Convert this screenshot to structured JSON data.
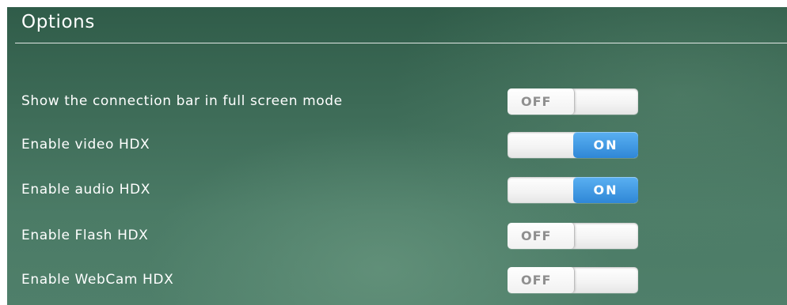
{
  "panel": {
    "title": "Options"
  },
  "options": [
    {
      "label": "Show the connection bar in full screen mode",
      "state": "OFF"
    },
    {
      "label": "Enable video HDX",
      "state": "ON"
    },
    {
      "label": "Enable audio HDX",
      "state": "ON"
    },
    {
      "label": "Enable Flash HDX",
      "state": "OFF"
    },
    {
      "label": "Enable WebCam HDX",
      "state": "OFF"
    }
  ],
  "colors": {
    "background": "#3f6e5a",
    "on_pill": "#3a92dd",
    "off_text": "#8f8f8f"
  }
}
